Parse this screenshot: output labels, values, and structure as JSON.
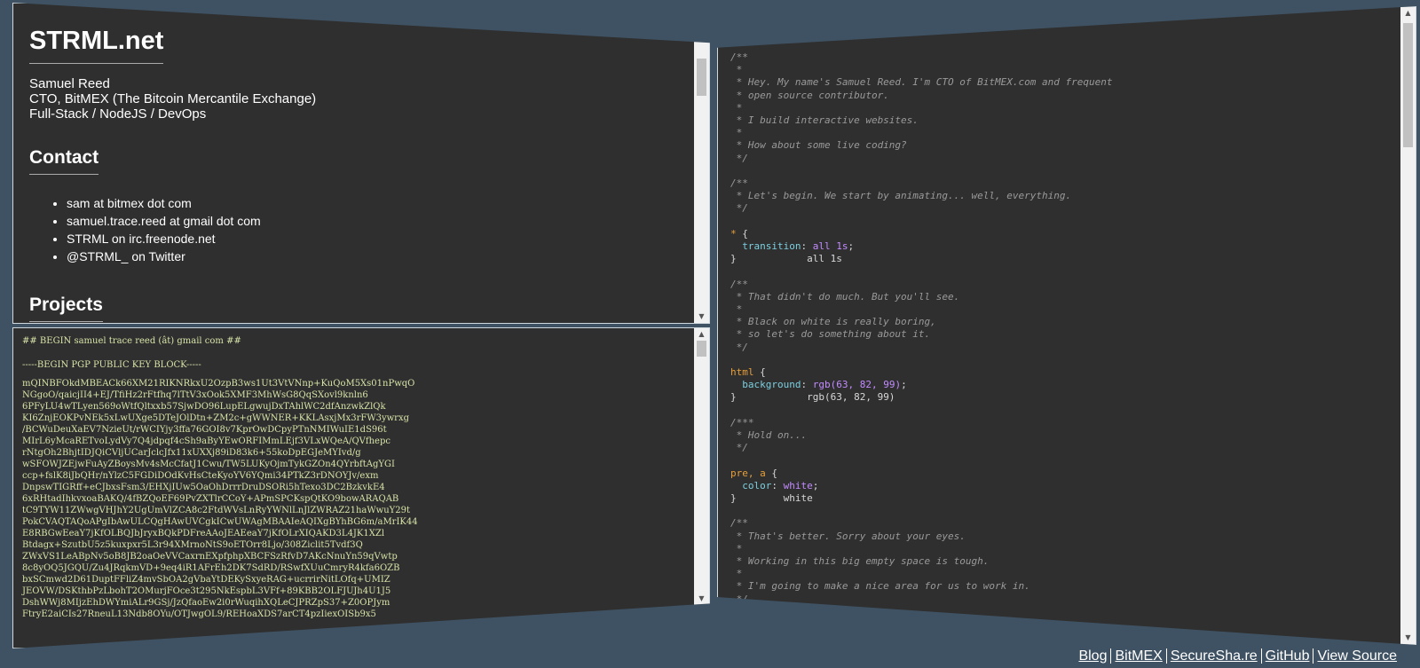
{
  "info": {
    "title": "STRML.net",
    "bio": [
      "Samuel Reed",
      "CTO, BitMEX (The Bitcoin Mercantile Exchange)",
      "Full-Stack / NodeJS / DevOps"
    ],
    "contact_heading": "Contact",
    "contacts": [
      "sam at bitmex dot com",
      "samuel.trace.reed at gmail dot com",
      "STRML on irc.freenode.net",
      "@STRML_ on Twitter"
    ],
    "projects_heading": "Projects"
  },
  "pgp": {
    "header": "## BEGIN samuel trace reed (ât) gmail com ##",
    "block_title": "-----BEGIN PGP PUBLIC KEY BLOCK-----",
    "lines": [
      "mQINBFOkdMBEACk66XM21RIKNRkxU2OzpB3ws1Ut3VtVNnp+KuQoM5Xs01nPwqO",
      "NGgoO/qaicjII4+EJ/TfiHz2rFtfhq7lTtV3xOok5XMF3MhWsG8QqSXovl9knln6",
      "6PFyLU4wTLyen569oWtfQltxxb57SjwDO96LupELgwujDxTAhlWC2dfAnzwkZlQk",
      "KI6ZnjEOKPvNEk5xLwUXge5DTeJOlDtn+ZM2c+gWWNER+KKLAsxjMx3rFW3ywrxg",
      "/BCWuDeuXaEV7NzieUt/rWCIYjy3ffa76GOI8v7KprOwDCpyPTnNMIWuIE1dS96t",
      "MIrL6yMcaRETvoLydVy7Q4jdpqf4cSh9aByYEwORFIMmLEjf3VLxWQeA/QVfhepc",
      "rNtgOh2BhjtIDJQiCVljUCarJclcJfx11xUXXj89iD83k6+55koDpEGJeMYIvd/g",
      "wSFOWJZEjwFuAyZBoysMv4sMcCfatJ1Cwu/TW5LUKyOjmTykGZOn4QYrbftAgYGI",
      "ccp+fslK8iJbQHr/nYlzC5FGDiDOdKvHsCteKyoYV6YQmi34PTkZ3rDNOYJv/exm",
      "DnpswTIGRff+eCJbxsFsm3/EHXjIUw5OaOhDrrrDruDSORi5hTexo3DC2BzkvkE4",
      "6xRHtadIhkvxoaBAKQ/4fBZQoEF69PvZXTlrCCoY+APmSPCKspQtKO9bowARAQAB",
      "tC9TYW11ZWwgVHJhY2UgUmVlZCA8c2FtdWVsLnRyYWNlLnJlZWRAZ21haWwuY29t",
      "PokCVAQTAQoAPgIbAwULCQgHAwUVCgkICwUWAgMBAAIeAQIXgBYhBG6m/aMrIK44",
      "E8RBGwEeaY7jKfOLBQJbJryxBQkPDFreAAoJEAEeaY7jKfOLrXIQAKD3L4JK1XZl",
      "Btdagx+SzutbU5z5kuxpxr5L3r94XMrnoNtS9oETOrr8Ljo/308Ziclit5Tvdf3Q",
      "ZWxVS1LeABpNv5oB8JB2oaOeVVCaxrnEXpfphpXBCFSzRfvD7AKcNnuYn59qVwtp",
      "8c8yOQ5JGQU/Zu4JRqkmVD+9eq4iR1AFrEh2DK7SdRD/RSwfXUuCmryR4kfa6OZB",
      "bxSCmwd2D61DuptFFliZ4mvSbOA2gVbaYtDEKySxyeRAG+ucrrirNitLOfq+UMIZ",
      "JEOVW/DSKthbPzLbohT2OMurjFOce3t295NkEspbL3VFf+89KBB2OLFJUJh4U1J5",
      "DshWWj8MIjzEhDWYmiALr9GSj/JzQfaoEw2i0rWuqihXQLeCJPRZpS37+Z0OPJym",
      "FtryE2aiCIs27RneuL13Ndb8OYu/OTJwgOL9/REHoaXDS7arCT4pzIiexOISb9x5"
    ]
  },
  "code": {
    "lines": [
      [
        [
          "cmt",
          "/**"
        ]
      ],
      [
        [
          "cmt",
          " *"
        ]
      ],
      [
        [
          "cmt",
          " * Hey. My name's Samuel Reed. I'm CTO of BitMEX.com and frequent"
        ]
      ],
      [
        [
          "cmt",
          " * open source contributor."
        ]
      ],
      [
        [
          "cmt",
          " *"
        ]
      ],
      [
        [
          "cmt",
          " * I build interactive websites."
        ]
      ],
      [
        [
          "cmt",
          " *"
        ]
      ],
      [
        [
          "cmt",
          " * How about some live coding?"
        ]
      ],
      [
        [
          "cmt",
          " */"
        ]
      ],
      [],
      [
        [
          "cmt",
          "/**"
        ]
      ],
      [
        [
          "cmt",
          " * Let's begin. We start by animating... well, everything."
        ]
      ],
      [
        [
          "cmt",
          " */"
        ]
      ],
      [],
      [
        [
          "sel",
          "*"
        ],
        [
          "punc",
          " {"
        ]
      ],
      [
        [
          "prop",
          "  transition"
        ],
        [
          "punc",
          ": "
        ],
        [
          "val",
          "all 1s"
        ],
        [
          "punc",
          ";"
        ]
      ],
      [
        [
          "punc",
          "}"
        ],
        [
          "plain",
          "            all 1s"
        ]
      ],
      [],
      [
        [
          "cmt",
          "/**"
        ]
      ],
      [
        [
          "cmt",
          " * That didn't do much. But you'll see."
        ]
      ],
      [
        [
          "cmt",
          " *"
        ]
      ],
      [
        [
          "cmt",
          " * Black on white is really boring,"
        ]
      ],
      [
        [
          "cmt",
          " * so let's do something about it."
        ]
      ],
      [
        [
          "cmt",
          " */"
        ]
      ],
      [],
      [
        [
          "sel",
          "html"
        ],
        [
          "punc",
          " {"
        ]
      ],
      [
        [
          "prop",
          "  background"
        ],
        [
          "punc",
          ": "
        ],
        [
          "val",
          "rgb(63, 82, 99)"
        ],
        [
          "punc",
          ";"
        ]
      ],
      [
        [
          "punc",
          "}"
        ],
        [
          "plain",
          "            rgb(63, 82, 99)"
        ]
      ],
      [],
      [
        [
          "cmt",
          "/***"
        ]
      ],
      [
        [
          "cmt",
          " * Hold on..."
        ]
      ],
      [
        [
          "cmt",
          " */"
        ]
      ],
      [],
      [
        [
          "sel",
          "pre, a"
        ],
        [
          "punc",
          " {"
        ]
      ],
      [
        [
          "prop",
          "  color"
        ],
        [
          "punc",
          ": "
        ],
        [
          "val",
          "white"
        ],
        [
          "punc",
          ";"
        ]
      ],
      [
        [
          "punc",
          "}"
        ],
        [
          "plain",
          "        white"
        ]
      ],
      [],
      [
        [
          "cmt",
          "/**"
        ]
      ],
      [
        [
          "cmt",
          " * That's better. Sorry about your eyes."
        ]
      ],
      [
        [
          "cmt",
          " *"
        ]
      ],
      [
        [
          "cmt",
          " * Working in this big empty space is tough."
        ]
      ],
      [
        [
          "cmt",
          " *"
        ]
      ],
      [
        [
          "cmt",
          " * I'm going to make a nice area for us to work in."
        ]
      ],
      [
        [
          "cmt",
          " */"
        ]
      ]
    ]
  },
  "footer": {
    "links": [
      "Blog",
      "BitMEX",
      "SecureSha.re",
      "GitHub",
      "View Source"
    ]
  },
  "colors": {
    "background": "#3f5263",
    "pane": "#2f2f2f",
    "comment": "#9a9a9a",
    "selector": "#e69f3a",
    "property": "#7ccfe0",
    "value": "#c38bff",
    "pgp_text": "#d7e4a8"
  },
  "icons": {
    "scroll_up": "scroll-up-arrow-icon",
    "scroll_down": "scroll-down-arrow-icon"
  }
}
